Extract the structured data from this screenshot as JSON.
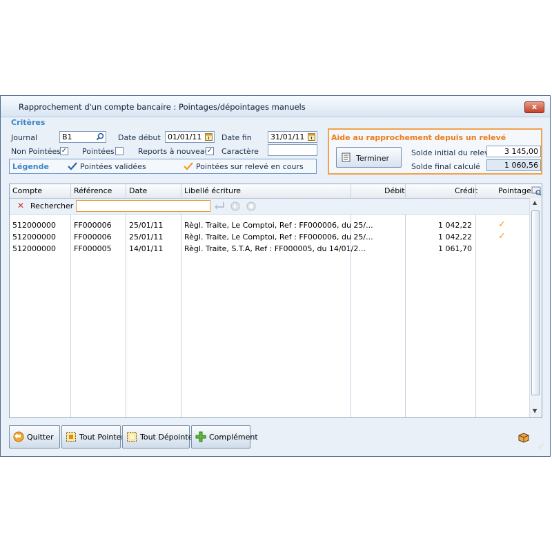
{
  "window": {
    "title": "Rapprochement d'un compte bancaire : Pointages/dépointages manuels",
    "close_label": "x"
  },
  "criteria": {
    "section_title": "Critères",
    "journal_label": "Journal",
    "journal_value": "B1",
    "date_debut_label": "Date début",
    "date_debut_value": "01/01/11",
    "date_fin_label": "Date fin",
    "date_fin_value": "31/01/11",
    "non_pointees_label": "Non Pointées",
    "non_pointees_checked": true,
    "pointees_label": "Pointées",
    "pointees_checked": false,
    "reports_label": "Reports à nouveau",
    "reports_checked": true,
    "caractere_label": "Caractère",
    "caractere_value": ""
  },
  "legend": {
    "title": "Légende",
    "validated_label": "Pointées validées",
    "current_label": "Pointées sur relevé en cours",
    "validated_color": "#2f5fa8",
    "current_color": "#f29a1f"
  },
  "aide": {
    "title": "Aide au rapprochement depuis un relevé",
    "terminer_label": "Terminer",
    "solde_initial_label": "Solde initial du relevé",
    "solde_initial_value": "3 145,00",
    "solde_final_label": "Solde final calculé",
    "solde_final_value": "1 060,56"
  },
  "table": {
    "columns": [
      "Compte",
      "Référence",
      "Date",
      "Libellé écriture",
      "Débit",
      "Crédit",
      "Pointage"
    ],
    "search_label": "Rechercher :",
    "search_value": "",
    "rows": [
      {
        "compte": "512000000",
        "reference": "FF000006",
        "date": "25/01/11",
        "libelle": "Règl. Traite, Le Comptoi, Ref : FF000006, du 25/...",
        "debit": "",
        "credit": "1 042,22",
        "pointage": "✓"
      },
      {
        "compte": "512000000",
        "reference": "FF000006",
        "date": "25/01/11",
        "libelle": "Règl. Traite, Le Comptoi, Ref : FF000006, du 25/...",
        "debit": "",
        "credit": "1 042,22",
        "pointage": "✓"
      },
      {
        "compte": "512000000",
        "reference": "FF000005",
        "date": "14/01/11",
        "libelle": "Règl. Traite, S.T.A, Ref : FF000005, du 14/01/2...",
        "debit": "",
        "credit": "1 061,70",
        "pointage": ""
      }
    ]
  },
  "footer": {
    "quitter_label": "Quitter",
    "tout_pointer_label": "Tout Pointer",
    "tout_depointer_label": "Tout Dépointer",
    "complement_label": "Complément"
  },
  "colors": {
    "accent_orange": "#f0a24a",
    "accent_blue": "#3b86c8"
  }
}
